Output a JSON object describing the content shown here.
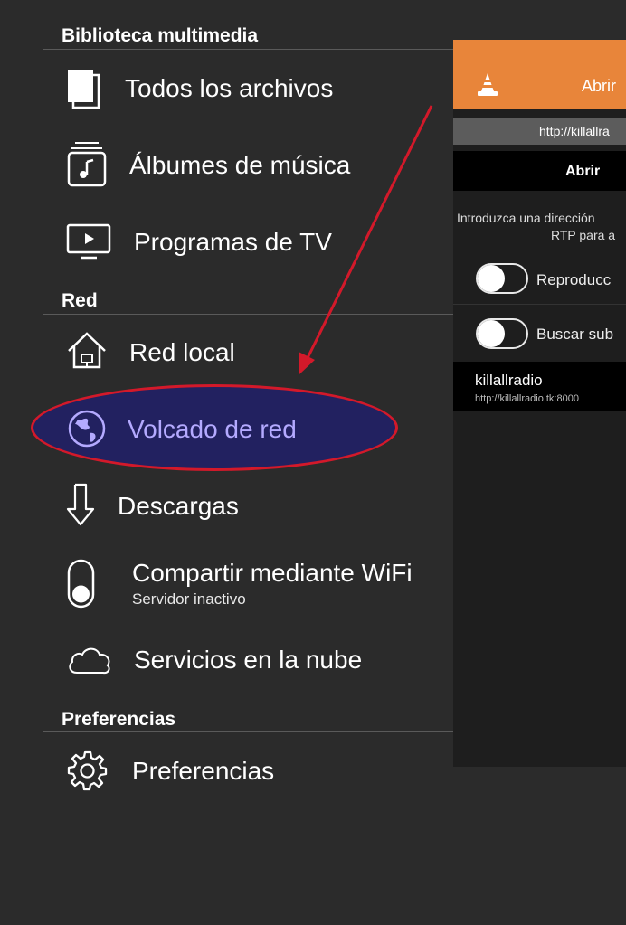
{
  "sidebar": {
    "sections": {
      "library": "Biblioteca multimedia",
      "network": "Red",
      "prefs": "Preferencias"
    },
    "items": [
      {
        "label": "Todos los archivos",
        "icon": "files-icon"
      },
      {
        "label": "Álbumes de música",
        "icon": "music-album-icon"
      },
      {
        "label": "Programas de TV",
        "icon": "tv-icon"
      },
      {
        "label": "Red local",
        "icon": "home-network-icon"
      },
      {
        "label": "Volcado de red",
        "icon": "globe-icon",
        "selected": true
      },
      {
        "label": "Descargas",
        "icon": "download-arrow-icon"
      },
      {
        "label": "Compartir mediante WiFi",
        "sublabel": "Servidor inactivo",
        "icon": "wifi-toggle-icon"
      },
      {
        "label": "Servicios en la nube",
        "icon": "cloud-icon"
      },
      {
        "label": "Preferencias",
        "icon": "gear-icon"
      }
    ]
  },
  "panel": {
    "title": "Abrir",
    "url": "http://killallra",
    "open_button": "Abrir",
    "description_line1": "Introduzca una dirección",
    "description_line2": "RTP para a",
    "toggle1_label": "Reproducc",
    "toggle2_label": "Buscar sub",
    "stream_title": "killallradio",
    "stream_url": "http://killallradio.tk:8000"
  },
  "colors": {
    "background": "#2b2b2b",
    "accent_orange": "#e8853a",
    "selected_fill": "#222160",
    "selected_text": "#b4aaff",
    "annotation_red": "#d3192a"
  }
}
